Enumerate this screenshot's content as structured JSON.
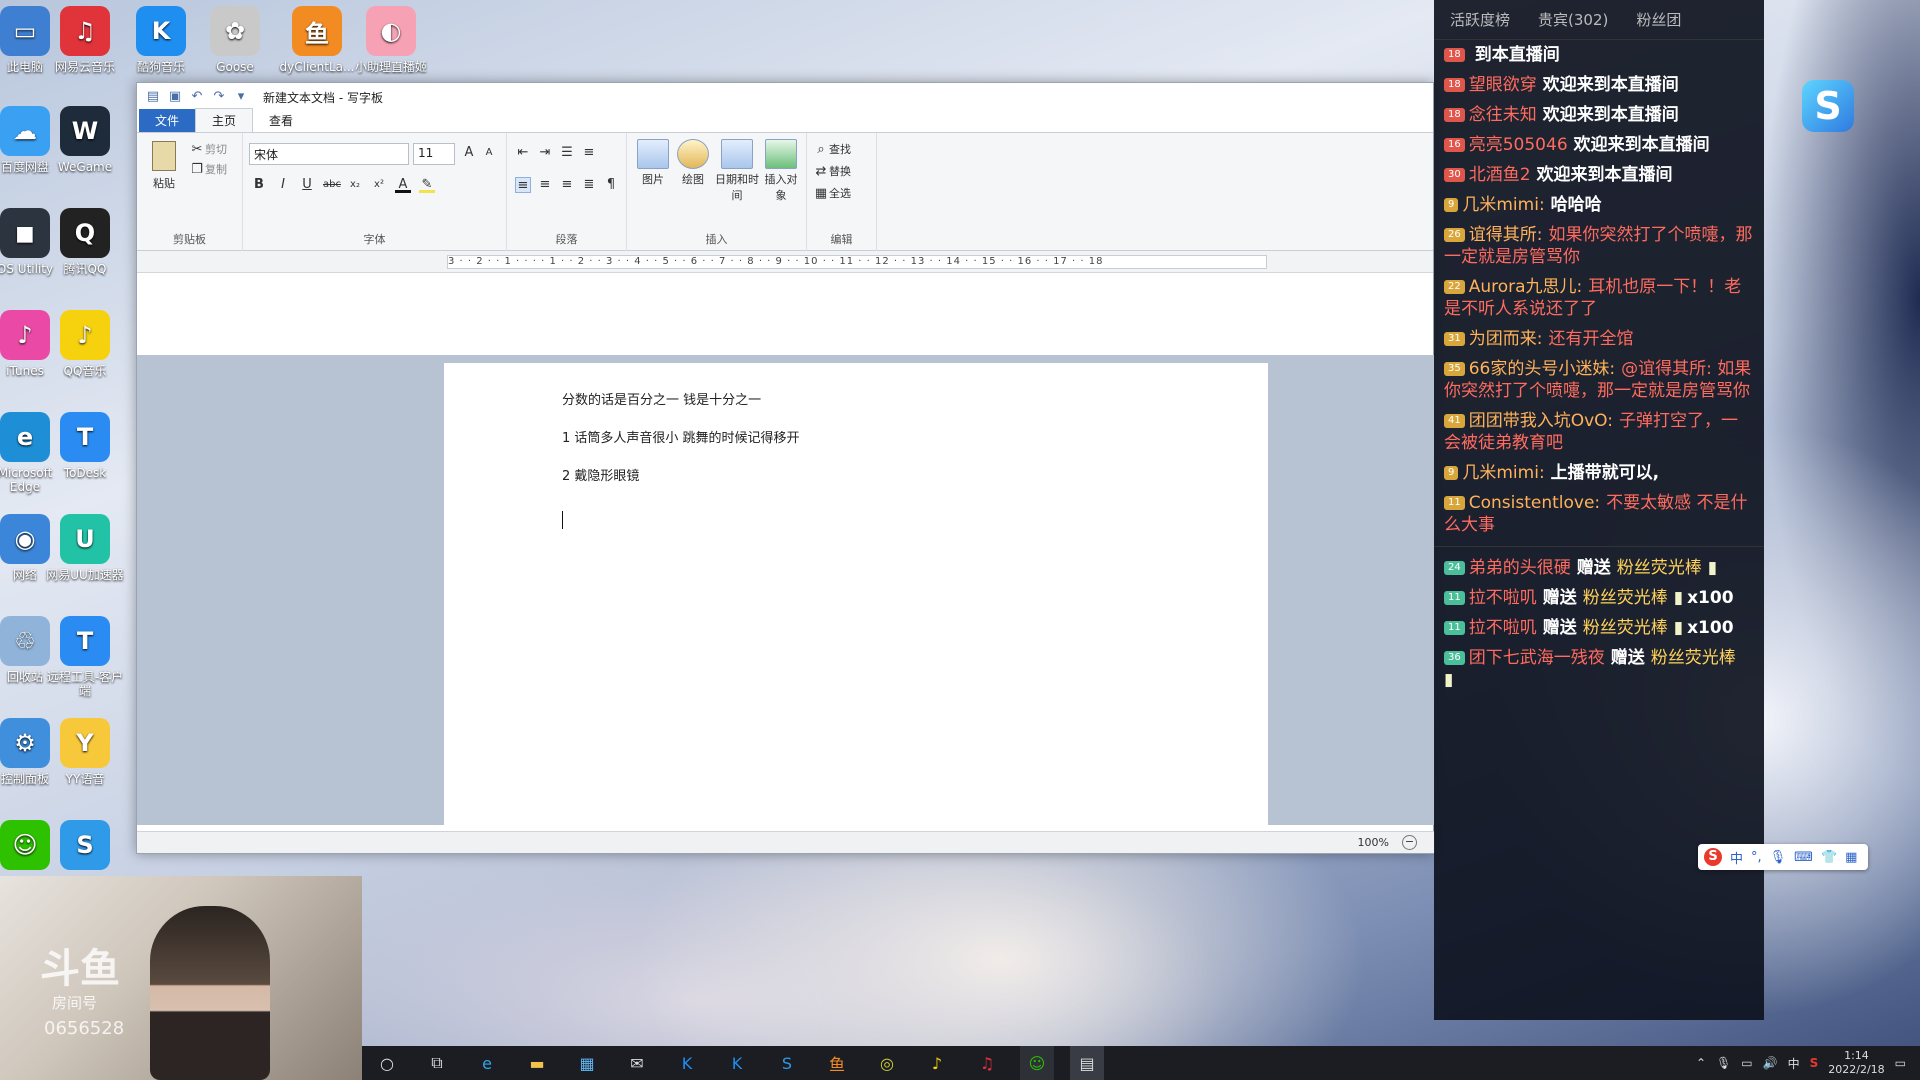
{
  "desktop_icons": [
    {
      "label": "此电脑",
      "glyph": "▭",
      "color": "#3f7fd1"
    },
    {
      "label": "网易云音乐",
      "glyph": "♫",
      "color": "#e0333a"
    },
    {
      "label": "酷狗音乐",
      "glyph": "K",
      "color": "#1f8ef1"
    },
    {
      "label": "Goose",
      "glyph": "✿",
      "color": "#c9c9c9"
    },
    {
      "label": "dyClientLa...",
      "glyph": "鱼",
      "color": "#f28b21"
    },
    {
      "label": "小助理直播姬",
      "glyph": "◐",
      "color": "#f7a1b5"
    },
    {
      "label": "百度网盘",
      "glyph": "☁",
      "color": "#3aa0f2"
    },
    {
      "label": "WeGame",
      "glyph": "W",
      "color": "#1d2b3a"
    },
    {
      "label": "OS Utility",
      "glyph": "◼",
      "color": "#2c3440"
    },
    {
      "label": "腾讯QQ",
      "glyph": "Q",
      "color": "#222"
    },
    {
      "label": "iTunes",
      "glyph": "♪",
      "color": "#ea4aa6"
    },
    {
      "label": "QQ音乐",
      "glyph": "♪",
      "color": "#f5d10e"
    },
    {
      "label": "Microsoft Edge",
      "glyph": "e",
      "color": "#1e8fd6"
    },
    {
      "label": "ToDesk",
      "glyph": "T",
      "color": "#2a8cf2"
    },
    {
      "label": "网络",
      "glyph": "◉",
      "color": "#3b86d8"
    },
    {
      "label": "网易UU加速器",
      "glyph": "U",
      "color": "#21c2a6"
    },
    {
      "label": "回收站",
      "glyph": "♲",
      "color": "#8fb3d9"
    },
    {
      "label": "远程工具-客户端",
      "glyph": "T",
      "color": "#2a8cf2"
    },
    {
      "label": "控制面板",
      "glyph": "⚙",
      "color": "#3f8fdc"
    },
    {
      "label": "YY语音",
      "glyph": "Y",
      "color": "#f7c93a"
    },
    {
      "label": "",
      "glyph": "☺",
      "color": "#2dc100"
    },
    {
      "label": "",
      "glyph": "S",
      "color": "#2f9ae8"
    }
  ],
  "wordpad": {
    "title": "新建文本文档 - 写字板",
    "tabs": [
      "文件",
      "主页",
      "查看"
    ],
    "clipboard": {
      "paste": "粘贴",
      "cut": "剪切",
      "copy": "复制",
      "group": "剪贴板"
    },
    "font": {
      "name": "宋体",
      "size": "11",
      "group": "字体"
    },
    "paragraph": {
      "group": "段落"
    },
    "insert": {
      "picture": "图片",
      "draw": "绘图",
      "datetime": "日期和时间",
      "object": "插入对象",
      "group": "插入"
    },
    "edit": {
      "find": "查找",
      "replace": "替换",
      "selectall": "全选",
      "group": "编辑"
    },
    "ruler": "3 · · 2 · · 1 · · · · 1 · · 2 · · 3 · · 4 · · 5 · · 6 · · 7 · · 8 · · 9 · · 10 · · 11 · · 12 · · 13 · · 14 · · 15 · · 16 · · 17 · · 18",
    "doc": [
      "分数的话是百分之一  钱是十分之一",
      "1  话筒多人声音很小  跳舞的时候记得移开",
      "2  戴隐形眼镜"
    ],
    "zoom": "100%"
  },
  "chat": {
    "tabs": [
      "活跃度榜",
      "贵宾(302)",
      "粉丝团"
    ],
    "messages": [
      {
        "level": "18",
        "nick": "",
        "text": "到本直播间"
      },
      {
        "level": "18",
        "nick": "望眼欲穿",
        "text": "欢迎来到本直播间"
      },
      {
        "level": "18",
        "nick": "念往未知",
        "text": "欢迎来到本直播间"
      },
      {
        "level": "16",
        "nick": "亮亮505046",
        "text": "欢迎来到本直播间"
      },
      {
        "level": "30",
        "nick": "北酒鱼2",
        "text": "欢迎来到本直播间"
      },
      {
        "level": "9",
        "nick": "几米mimi:",
        "text": "哈哈哈"
      },
      {
        "level": "26",
        "nick": "谊得其所:",
        "text": "如果你突然打了个喷嚏，那一定就是房管骂你"
      },
      {
        "level": "22",
        "nick": "Aurora九思儿:",
        "text": "耳机也原一下！！老是不听人系说还了了"
      },
      {
        "level": "31",
        "nick": "为团而来:",
        "text": "还有开全馆"
      },
      {
        "level": "35",
        "nick": "66家的头号小迷妹:",
        "text": "@谊得其所: 如果你突然打了个喷嚏，那一定就是房管骂你"
      },
      {
        "level": "41",
        "nick": "团团带我入坑OvO:",
        "text": "子弹打空了，一会被徒弟教育吧"
      },
      {
        "level": "9",
        "nick": "几米mimi:",
        "text": "上播带就可以,"
      },
      {
        "level": "11",
        "nick": "Consistentlove:",
        "text": "不要太敏感 不是什么大事"
      }
    ],
    "gifts": [
      {
        "level": "24",
        "nick": "弟弟的头很硬",
        "action": "赠送",
        "gift": "粉丝荧光棒",
        "count": ""
      },
      {
        "level": "11",
        "nick": "拉不啦叽",
        "action": "赠送",
        "gift": "粉丝荧光棒",
        "count": "x100"
      },
      {
        "level": "11",
        "nick": "拉不啦叽",
        "action": "赠送",
        "gift": "粉丝荧光棒",
        "count": "x100"
      },
      {
        "level": "36",
        "nick": "团下七武海一残夜",
        "action": "赠送",
        "gift": "粉丝荧光棒",
        "count": ""
      }
    ]
  },
  "webcam": {
    "watermark": "斗鱼",
    "room_label": "房间号",
    "room_no": "0656528"
  },
  "ime": {
    "mode": "中"
  },
  "tray": {
    "ime": "中",
    "time": "1:14",
    "date": "2022/2/18"
  }
}
